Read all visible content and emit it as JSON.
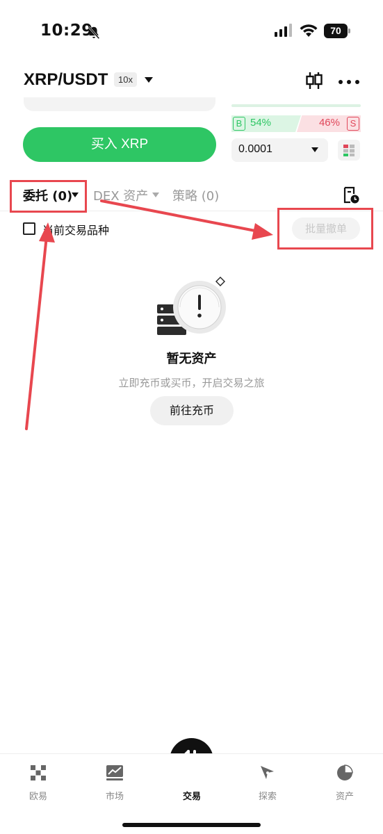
{
  "status_bar": {
    "time": "10:29",
    "battery": "70",
    "icons": [
      "bell-slash-icon",
      "signal-icon",
      "wifi-icon",
      "battery-icon"
    ]
  },
  "header": {
    "pair": "XRP/USDT",
    "leverage": "10x",
    "icons": [
      "chevron-down-icon",
      "candlestick-icon",
      "more-icon"
    ]
  },
  "trade_panel": {
    "buy_button_label": "买入 XRP",
    "buy_ratio": "54%",
    "sell_ratio": "46%",
    "buy_badge": "B",
    "sell_badge": "S",
    "precision": "0.0001",
    "colors": {
      "buy": "#2ec664",
      "sell": "#e0475a"
    }
  },
  "tabs": {
    "orders": "委托 (0)",
    "dex_assets": "DEX 资产",
    "strategy": "策略 (0)"
  },
  "filter": {
    "current_only_label": "当前交易品种",
    "batch_cancel_label": "批量撤单"
  },
  "empty_state": {
    "title": "暂无资产",
    "subtitle": "立即充币或买币，开启交易之旅",
    "button_label": "前往充币"
  },
  "bottom_nav": {
    "items": [
      {
        "label": "欧易",
        "icon": "okx-logo-icon"
      },
      {
        "label": "市场",
        "icon": "market-chart-icon"
      },
      {
        "label": "交易",
        "icon": "trade-swap-icon"
      },
      {
        "label": "探索",
        "icon": "compass-icon"
      },
      {
        "label": "资产",
        "icon": "pie-chart-icon"
      }
    ],
    "active": "交易"
  },
  "annotation": {
    "color": "#e8474f"
  }
}
